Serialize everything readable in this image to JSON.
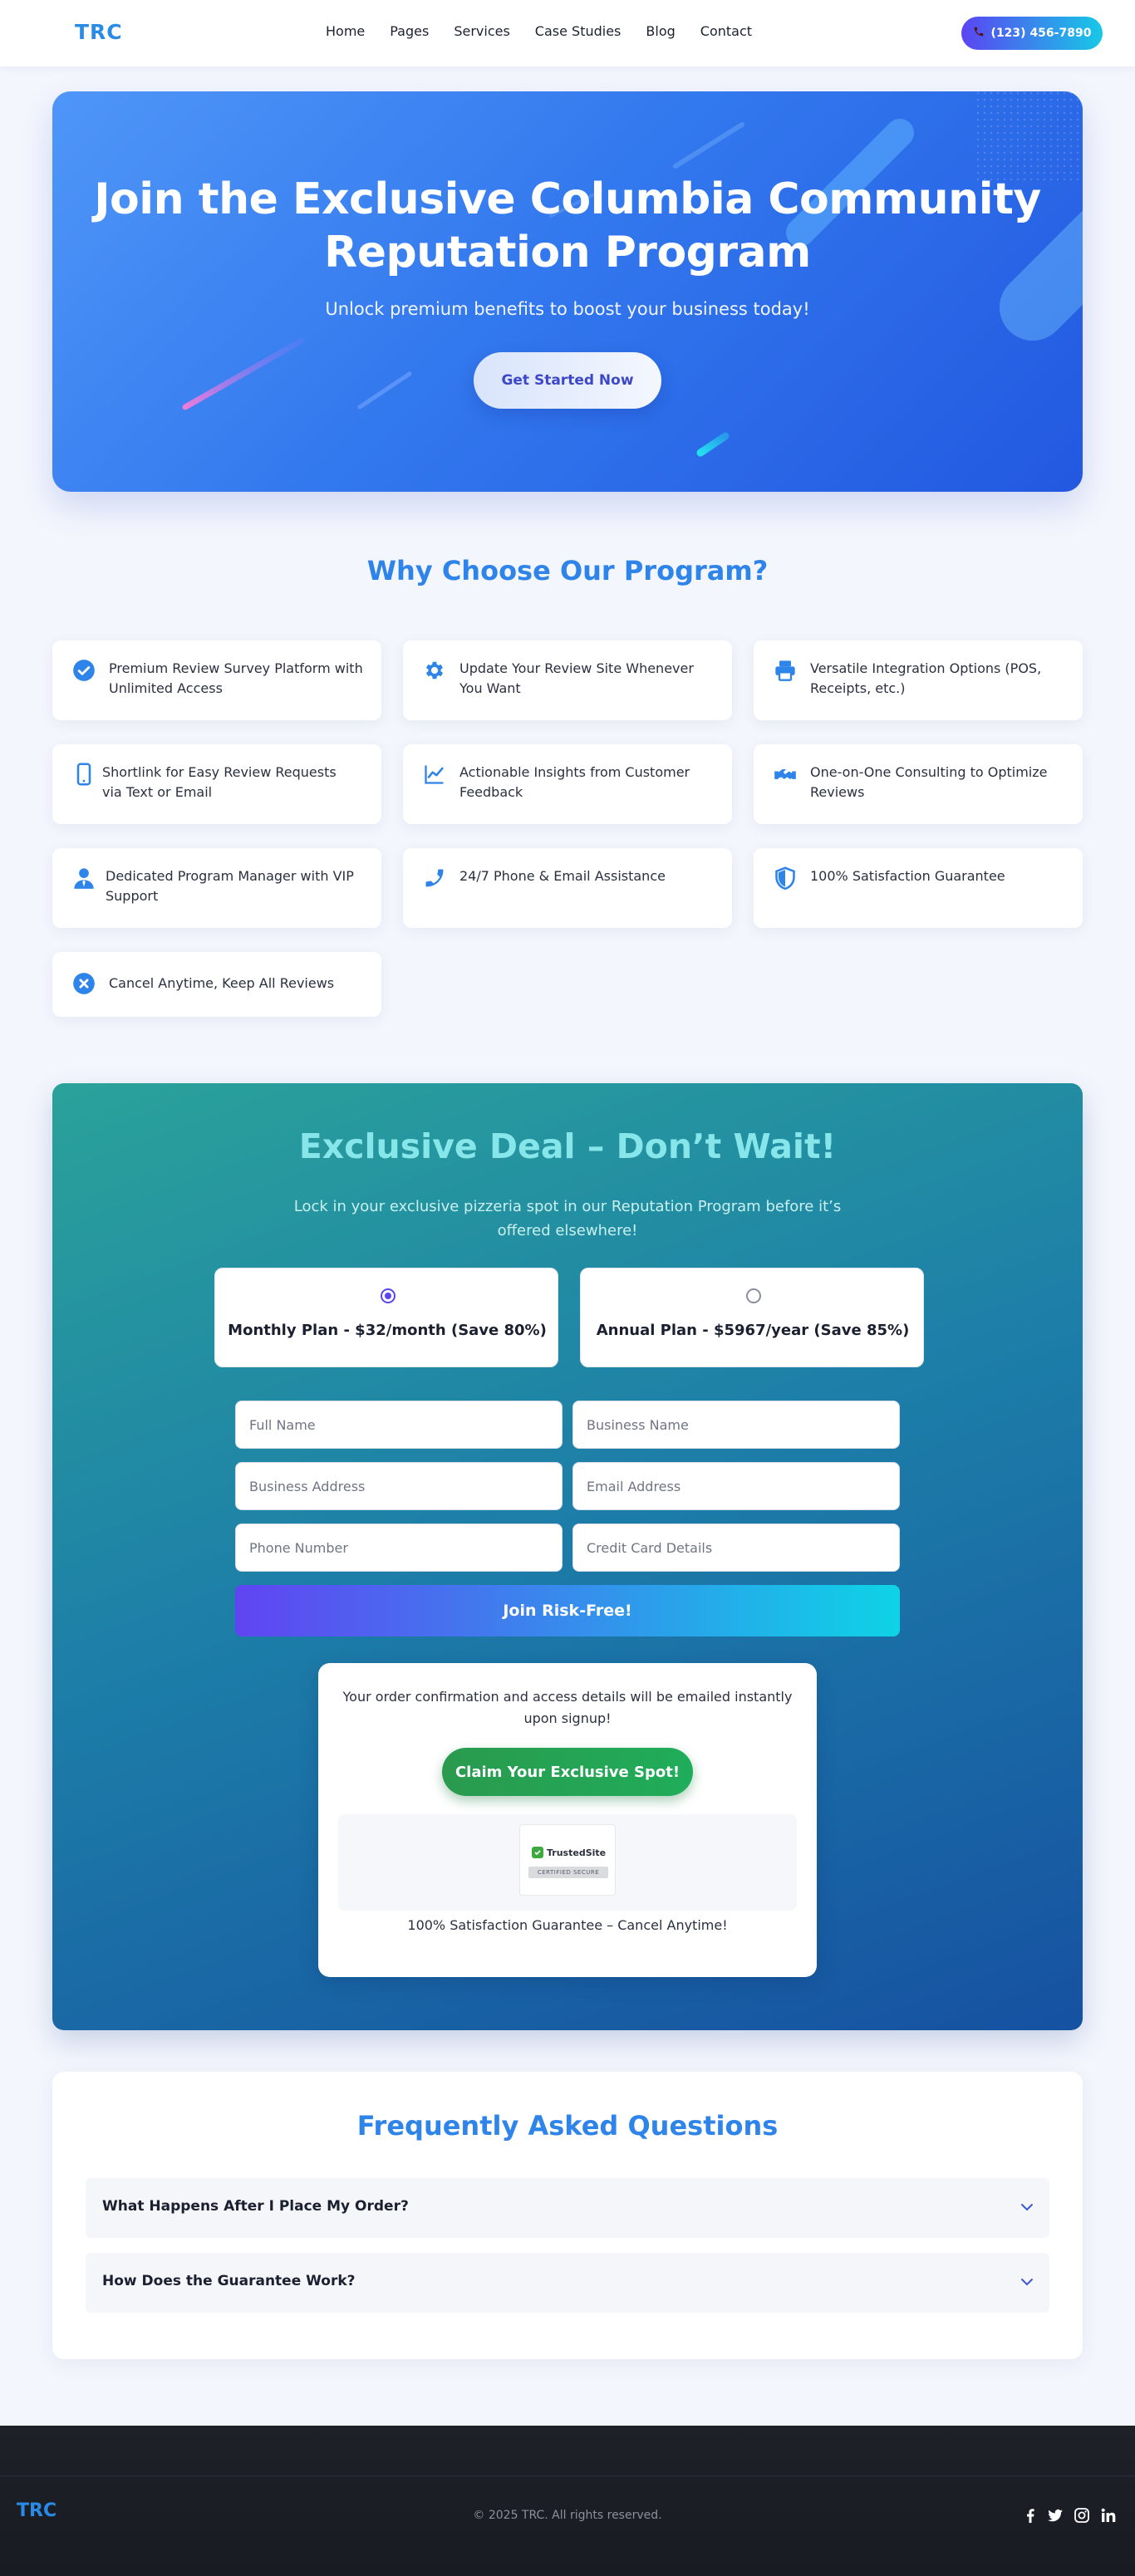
{
  "nav": {
    "logo": "TRC",
    "links": [
      "Home",
      "Pages",
      "Services",
      "Case Studies",
      "Blog",
      "Contact"
    ],
    "phone": "(123) 456-7890",
    "phone_icon": "phone-icon"
  },
  "hero": {
    "title": "Join the Exclusive Columbia Community Reputation Program",
    "subtitle": "Unlock premium benefits to boost your business today!",
    "cta": "Get Started Now"
  },
  "why": {
    "title": "Why Choose Our Program?",
    "features": [
      {
        "icon": "check-circle-icon",
        "text": "Premium Review Survey Platform with Unlimited Access"
      },
      {
        "icon": "gear-icon",
        "text": "Update Your Review Site Whenever You Want"
      },
      {
        "icon": "printer-icon",
        "text": "Versatile Integration Options (POS, Receipts, etc.)"
      },
      {
        "icon": "mobile-icon",
        "text": "Shortlink for Easy Review Requests via Text or Email"
      },
      {
        "icon": "chart-line-icon",
        "text": "Actionable Insights from Customer Feedback"
      },
      {
        "icon": "handshake-icon",
        "text": "One-on-One Consulting to Optimize Reviews"
      },
      {
        "icon": "user-tie-icon",
        "text": "Dedicated Program Manager with VIP Support"
      },
      {
        "icon": "phone-icon",
        "text": "24/7 Phone & Email Assistance"
      },
      {
        "icon": "shield-icon",
        "text": "100% Satisfaction Guarantee"
      },
      {
        "icon": "cancel-circle-icon",
        "text": "Cancel Anytime, Keep All Reviews"
      }
    ],
    "icon_color": "#2f84ea"
  },
  "deal": {
    "title": "Exclusive Deal – Don’t Wait!",
    "subtitle": "Lock in your exclusive pizzeria spot in our Reputation Program before it’s offered elsewhere!",
    "plans": [
      {
        "label": "Monthly Plan - $32/month (",
        "save": "Save 80%",
        "close": ")",
        "selected": true
      },
      {
        "label": "Annual Plan - $5967/year (",
        "save": "Save 85%",
        "close": ")",
        "selected": false
      }
    ],
    "fields": {
      "full_name": "Full Name",
      "business_name": "Business Name",
      "business_address": "Business Address",
      "email": "Email Address",
      "phone": "Phone Number",
      "card": "Credit Card Details"
    },
    "submit": "Join Risk-Free!",
    "confirm_text": "Your order confirmation and access details will be emailed instantly upon signup!",
    "claim": "Claim Your Exclusive Spot!",
    "trust_name": "TrustedSite",
    "trust_sub": "CERTIFIED SECURE",
    "guarantee": "100% Satisfaction Guarantee – Cancel Anytime!"
  },
  "faq": {
    "title": "Frequently Asked Questions",
    "items": [
      {
        "q": "What Happens After I Place My Order?"
      },
      {
        "q": "How Does the Guarantee Work?"
      }
    ]
  },
  "footer": {
    "logo": "TRC",
    "copyright": "© 2025 TRC. All rights reserved.",
    "social": [
      "facebook-icon",
      "twitter-icon",
      "instagram-icon",
      "linkedin-icon"
    ]
  }
}
